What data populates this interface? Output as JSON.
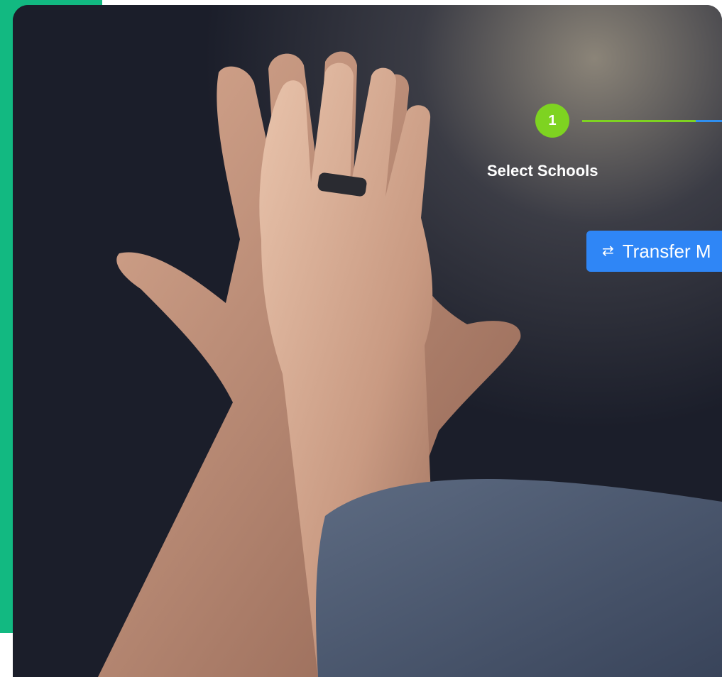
{
  "colors": {
    "accent_panel": "#12b981",
    "step_active": "#7ed321",
    "step_next_line": "#2f8ff0",
    "button_primary": "#2f86f6"
  },
  "stepper": {
    "steps": [
      {
        "number": "1",
        "label": "Select Schools",
        "state": "active"
      }
    ]
  },
  "actions": {
    "transfer_label": "Transfer M",
    "transfer_icon": "swap-arrows-icon"
  },
  "hero": {
    "image": "two-hands-high-five-photo"
  }
}
